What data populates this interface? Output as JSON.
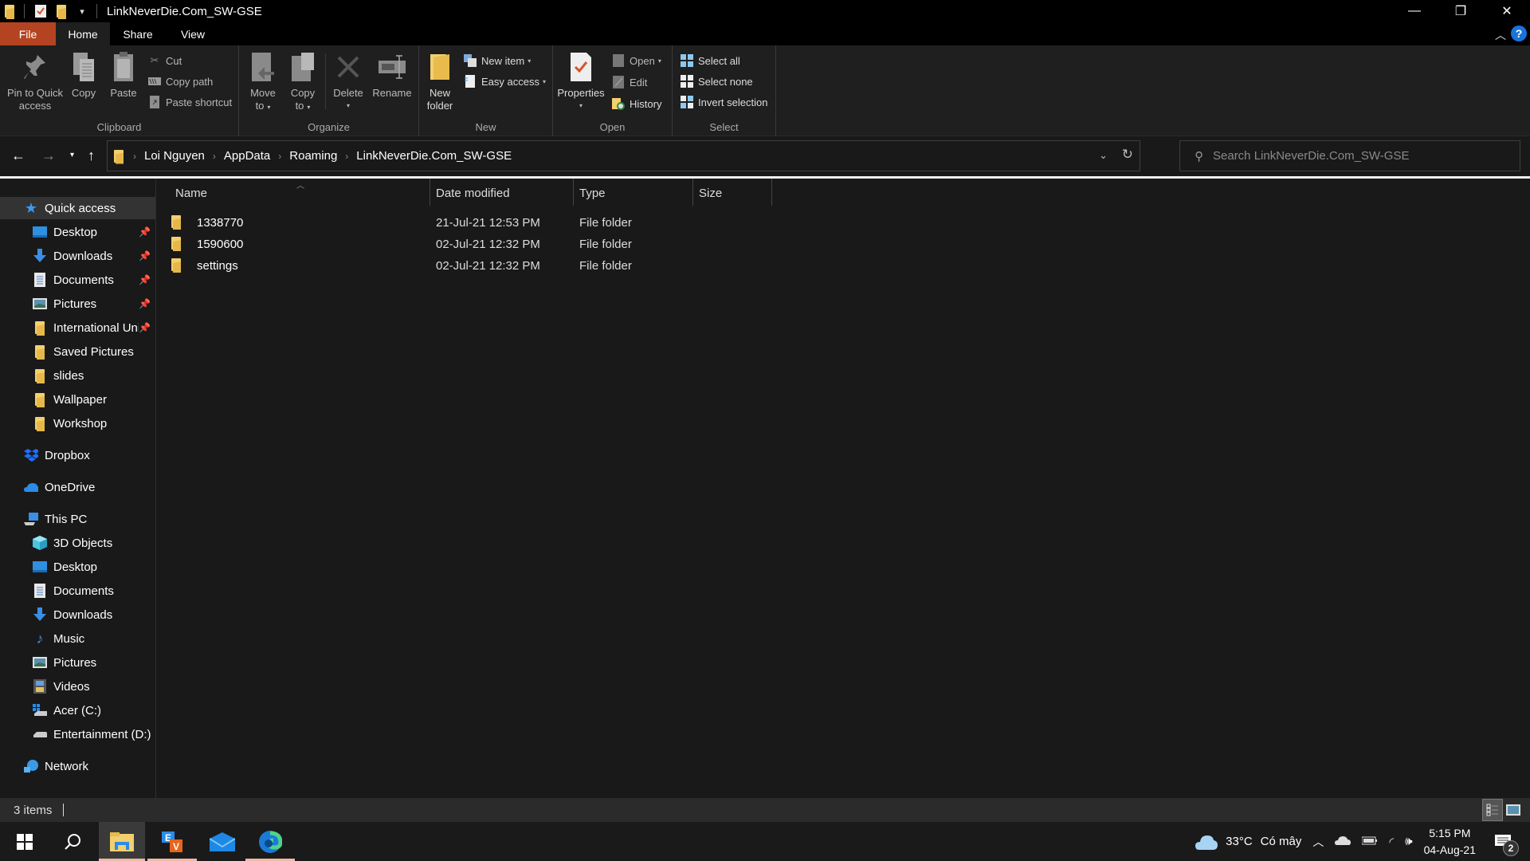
{
  "window": {
    "title": "LinkNeverDie.Com_SW-GSE",
    "controls": {
      "minimize": "—",
      "restore": "❐",
      "close": "✕"
    }
  },
  "ribbon_tabs": [
    {
      "label": "File",
      "active": false
    },
    {
      "label": "Home",
      "active": true
    },
    {
      "label": "Share",
      "active": false
    },
    {
      "label": "View",
      "active": false
    }
  ],
  "ribbon": {
    "clipboard": {
      "label": "Clipboard",
      "pin": "Pin to Quick access",
      "pin_line1": "Pin to Quick",
      "pin_line2": "access",
      "copy": "Copy",
      "paste": "Paste",
      "cut": "Cut",
      "copy_path": "Copy path",
      "paste_shortcut": "Paste shortcut"
    },
    "organize": {
      "label": "Organize",
      "move_to_1": "Move",
      "move_to_2": "to",
      "copy_to_1": "Copy",
      "copy_to_2": "to",
      "delete": "Delete",
      "rename": "Rename"
    },
    "new": {
      "label": "New",
      "new_folder_1": "New",
      "new_folder_2": "folder",
      "new_item": "New item",
      "easy_access": "Easy access"
    },
    "open": {
      "label": "Open",
      "properties": "Properties",
      "open": "Open",
      "edit": "Edit",
      "history": "History"
    },
    "select": {
      "label": "Select",
      "select_all": "Select all",
      "select_none": "Select none",
      "invert_selection": "Invert selection"
    }
  },
  "address": {
    "breadcrumbs": [
      "Loi Nguyen",
      "AppData",
      "Roaming",
      "LinkNeverDie.Com_SW-GSE"
    ],
    "search_placeholder": "Search LinkNeverDie.Com_SW-GSE",
    "search_value": ""
  },
  "sidebar": {
    "quick_access": {
      "label": "Quick access",
      "items": [
        {
          "label": "Desktop",
          "icon": "desktop-icon",
          "pinned": true
        },
        {
          "label": "Downloads",
          "icon": "downloads-icon",
          "pinned": true
        },
        {
          "label": "Documents",
          "icon": "documents-icon",
          "pinned": true
        },
        {
          "label": "Pictures",
          "icon": "pictures-icon",
          "pinned": true
        },
        {
          "label": "International Uni",
          "icon": "folder-icon",
          "pinned": true
        },
        {
          "label": "Saved Pictures",
          "icon": "folder-icon",
          "pinned": false
        },
        {
          "label": "slides",
          "icon": "folder-icon",
          "pinned": false
        },
        {
          "label": "Wallpaper",
          "icon": "folder-icon",
          "pinned": false
        },
        {
          "label": "Workshop",
          "icon": "folder-icon",
          "pinned": false
        }
      ]
    },
    "dropbox": "Dropbox",
    "onedrive": "OneDrive",
    "this_pc": {
      "label": "This PC",
      "items": [
        {
          "label": "3D Objects",
          "icon": "3d-objects-icon"
        },
        {
          "label": "Desktop",
          "icon": "desktop-icon"
        },
        {
          "label": "Documents",
          "icon": "documents-icon"
        },
        {
          "label": "Downloads",
          "icon": "downloads-icon"
        },
        {
          "label": "Music",
          "icon": "music-icon"
        },
        {
          "label": "Pictures",
          "icon": "pictures-icon"
        },
        {
          "label": "Videos",
          "icon": "videos-icon"
        },
        {
          "label": "Acer (C:)",
          "icon": "drive-c-icon"
        },
        {
          "label": "Entertainment (D:)",
          "icon": "drive-d-icon"
        }
      ]
    },
    "network": "Network"
  },
  "file_list": {
    "columns": [
      "Name",
      "Date modified",
      "Type",
      "Size"
    ],
    "rows": [
      {
        "name": "1338770",
        "date": "21-Jul-21 12:53 PM",
        "type": "File folder",
        "size": ""
      },
      {
        "name": "1590600",
        "date": "02-Jul-21 12:32 PM",
        "type": "File folder",
        "size": ""
      },
      {
        "name": "settings",
        "date": "02-Jul-21 12:32 PM",
        "type": "File folder",
        "size": ""
      }
    ]
  },
  "status": {
    "item_count": "3 items"
  },
  "taskbar": {
    "weather_temp": "33°C",
    "weather_desc": "Có mây",
    "time": "5:15 PM",
    "date": "04-Aug-21",
    "notification_count": "2"
  },
  "colors": {
    "file_tab": "#b44421",
    "ribbon_bg": "#1f1f1f",
    "window_bg": "#191919",
    "accent_blue": "#1a73d9",
    "folder_yellow": "#f3cf6e"
  }
}
